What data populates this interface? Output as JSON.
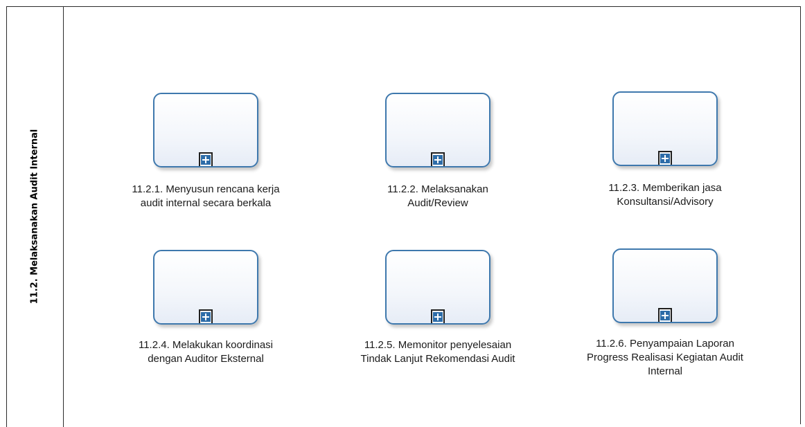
{
  "lane": {
    "title": "11.2. Melaksanakan Audit Internal"
  },
  "tasks": [
    {
      "id": "11.2.1",
      "lines": [
        "11.2.1. Menyusun rencana kerja",
        "audit internal secara berkala"
      ]
    },
    {
      "id": "11.2.2",
      "lines": [
        "11.2.2. Melaksanakan",
        "Audit/Review"
      ]
    },
    {
      "id": "11.2.3",
      "lines": [
        "11.2.3. Memberikan jasa",
        "Konsultansi/Advisory"
      ]
    },
    {
      "id": "11.2.4",
      "lines": [
        "11.2.4. Melakukan koordinasi",
        "dengan Auditor Eksternal"
      ]
    },
    {
      "id": "11.2.5",
      "lines": [
        "11.2.5. Memonitor penyelesaian",
        "Tindak Lanjut Rekomendasi Audit"
      ]
    },
    {
      "id": "11.2.6",
      "lines": [
        "11.2.6. Penyampaian Laporan",
        "Progress Realisasi Kegiatan Audit",
        "Internal"
      ]
    }
  ],
  "colors": {
    "task_border": "#3e78ad",
    "marker_fill": "#2d6ca8",
    "pool_line": "#2b2b2b"
  },
  "icons": {
    "subprocess_marker": "plus-square-icon"
  }
}
